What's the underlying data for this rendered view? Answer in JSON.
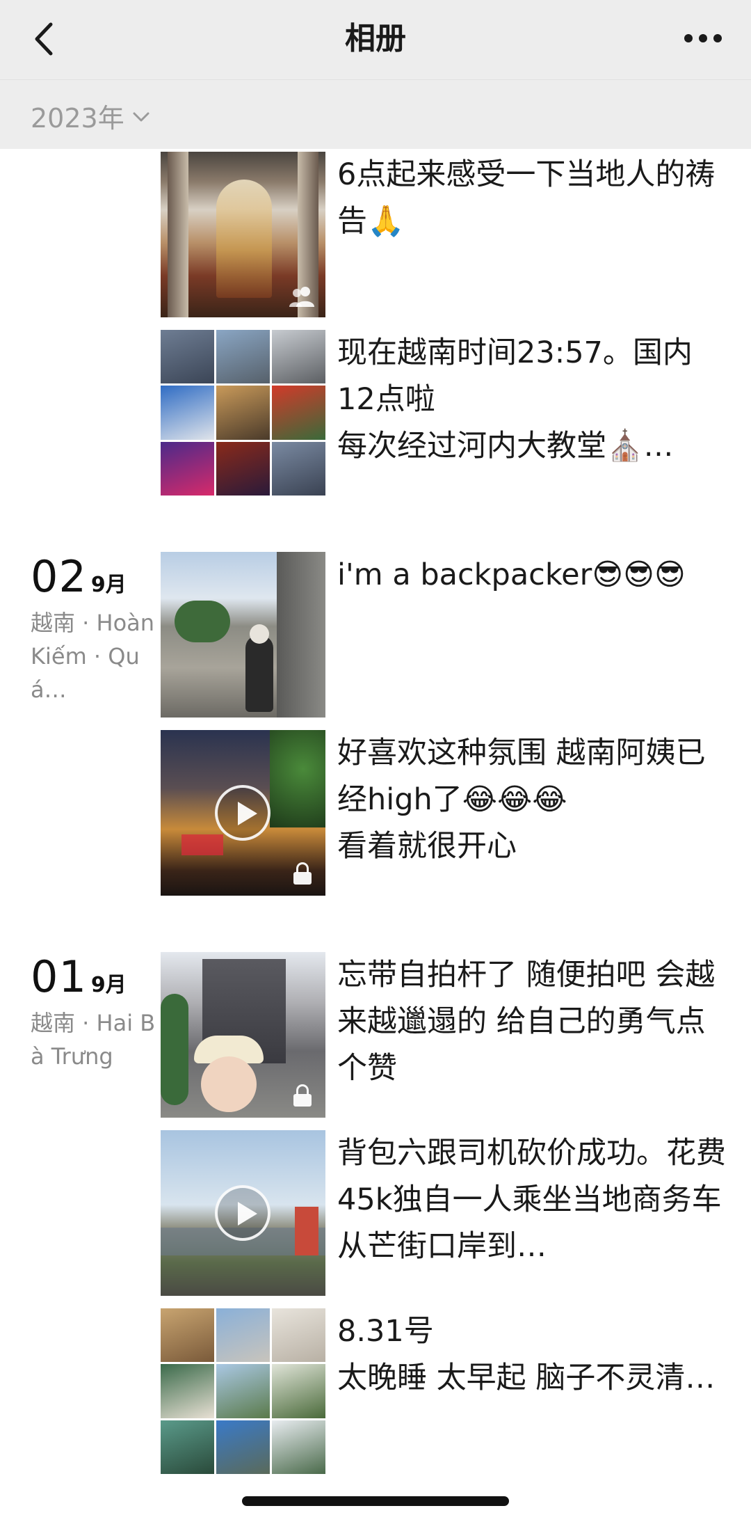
{
  "navbar": {
    "title": "相册",
    "back_icon": "chevron-left-icon",
    "more_icon": "more-dots-icon"
  },
  "year_filter": {
    "label": "2023年",
    "icon": "chevron-down-icon"
  },
  "feed": {
    "groups": [
      {
        "day": "",
        "month": "",
        "location": "",
        "posts": [
          {
            "text": "6点起来感受一下当地人的祷告🙏",
            "media": "photo",
            "badge": "people-icon"
          },
          {
            "text": "现在越南时间23:57。国内12点啦\n每次经过河内大教堂⛪…",
            "media": "grid"
          }
        ]
      },
      {
        "day": "02",
        "month": "9月",
        "location": "越南 · Hoàn Kiếm · Quá…",
        "posts": [
          {
            "text": "i'm a backpacker😎😎😎",
            "media": "photo"
          },
          {
            "text": "好喜欢这种氛围 越南阿姨已经high了😂😂😂\n看着就很开心",
            "media": "video",
            "badge": "lock-icon"
          }
        ]
      },
      {
        "day": "01",
        "month": "9月",
        "location": "越南 · Hai Bà Trưng",
        "posts": [
          {
            "text": "忘带自拍杆了 随便拍吧 会越来越邋遢的 给自己的勇气点个赞",
            "media": "photo",
            "badge": "lock-icon"
          },
          {
            "text": "背包六跟司机砍价成功。花费45k独自一人乘坐当地商务车从芒街口岸到…",
            "media": "video"
          },
          {
            "text": "8.31号\n太晚睡 太早起 脑子不灵清…",
            "media": "grid"
          }
        ]
      }
    ]
  },
  "colors": {
    "nav_bg": "#ededed",
    "text_primary": "#1a1a1a",
    "text_secondary": "#8a8a8a",
    "page_bg": "#ffffff"
  }
}
